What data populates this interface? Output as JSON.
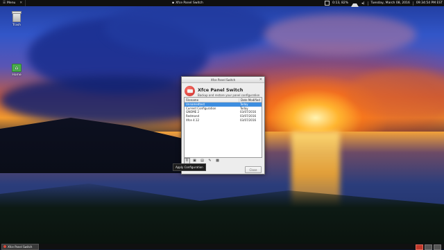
{
  "top_panel": {
    "menu_label": "Menu",
    "active_window_title": "Xfce Panel Switch",
    "battery": "0:13, 82%",
    "datetime": "Tuesday, March 08, 2016",
    "clock": "09:34:54 PM EST"
  },
  "desktop": {
    "icons": [
      {
        "label": "Trash"
      },
      {
        "label": "Home"
      }
    ]
  },
  "window": {
    "title": "Xfce Panel Switch",
    "app_name": "Xfce Panel Switch",
    "app_description": "Backup and restore your panel configuration",
    "columns": {
      "name": "Filename",
      "date": "Date Modified"
    },
    "rows": [
      {
        "name": "Unnamedtest",
        "date": "Today",
        "selected": true
      },
      {
        "name": "Current Configuration",
        "date": "Today",
        "selected": false
      },
      {
        "name": "GNOME 2",
        "date": "03/07/2016",
        "selected": false
      },
      {
        "name": "Redmond",
        "date": "03/07/2016",
        "selected": false
      },
      {
        "name": "Xfce 4.12",
        "date": "03/07/2016",
        "selected": false
      }
    ],
    "toolbar_icons": [
      "apply-icon",
      "save-icon",
      "export-icon",
      "settings-icon",
      "delete-icon"
    ],
    "close_label": "Close",
    "tooltip": "Apply Configuration"
  },
  "bottom_panel": {
    "task": "Xfce Panel Switch"
  },
  "colors": {
    "selection": "#3d8ee0",
    "panel": "#101010",
    "accent": "#c62828"
  }
}
